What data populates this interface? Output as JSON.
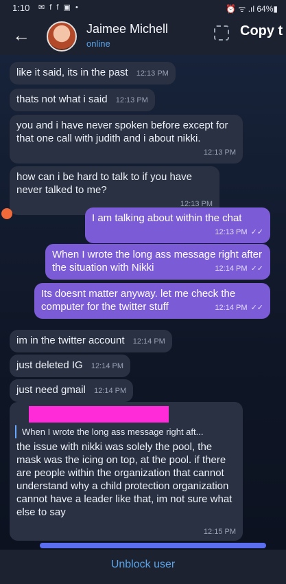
{
  "status_bar": {
    "time": "1:10",
    "notif_icons": "✉ f f ▣ •",
    "system": "⏰ ᯤ .ıl 64%▮"
  },
  "header": {
    "contact_name": "Jaimee Michell",
    "contact_status": "online",
    "copy_text": "Copy t"
  },
  "messages": [
    {
      "dir": "in",
      "text": "like it said, its in the past",
      "time": "12:13 PM"
    },
    {
      "dir": "in",
      "text": "thats not what i said",
      "time": "12:13 PM"
    },
    {
      "dir": "in",
      "text": "you and i have never spoken before except for that one call with judith and i about nikki.",
      "time": "12:13 PM"
    },
    {
      "dir": "in",
      "text": "how can i be hard to talk to if you have never talked to me?",
      "time": "12:13 PM"
    },
    {
      "dir": "out",
      "text": "I am talking about within the chat",
      "time": "12:13 PM",
      "ticks": "✓✓"
    },
    {
      "dir": "out",
      "text": "When I wrote the long ass message right after the situation with Nikki",
      "time": "12:14 PM",
      "ticks": "✓✓"
    },
    {
      "dir": "out",
      "text": "Its doesnt matter anyway. let me check the computer for the twitter stuff",
      "time": "12:14 PM",
      "ticks": "✓✓"
    },
    {
      "dir": "in",
      "text": "im in the twitter account",
      "time": "12:14 PM"
    },
    {
      "dir": "in",
      "text": "just deleted IG",
      "time": "12:14 PM"
    },
    {
      "dir": "in",
      "text": "just need gmail",
      "time": "12:14 PM"
    },
    {
      "dir": "in",
      "reply_quote": "When I wrote the long ass message right aft...",
      "text": "the issue with nikki was solely the pool, the mask was the icing on top, at the pool. if there are people within the organization that cannot understand why a child protection organization cannot have a leader like that, im not sure what else to say",
      "time": "12:15 PM"
    }
  ],
  "bottom": {
    "unblock_label": "Unblock user"
  },
  "colors": {
    "incoming_bubble": "#2a3142",
    "outgoing_bubble": "#7b5cd6",
    "accent_blue": "#5aa3e8",
    "redaction": "#ff2bd8"
  }
}
